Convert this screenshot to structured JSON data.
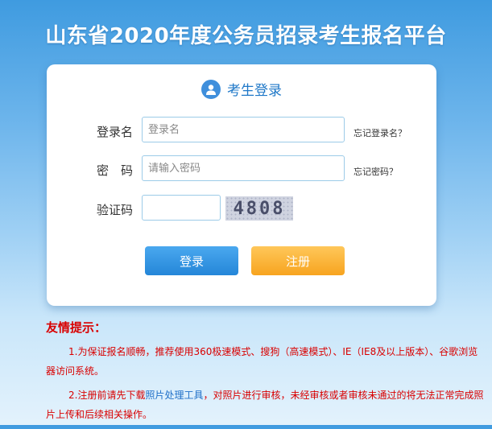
{
  "page": {
    "title": "山东省2020年度公务员招录考生报名平台"
  },
  "login": {
    "heading": "考生登录",
    "username_label": "登录名",
    "username_placeholder": "登录名",
    "forgot_username": "忘记登录名？",
    "password_label": "密　码",
    "password_placeholder": "请输入密码",
    "forgot_password": "忘记密码？",
    "captcha_label": "验证码",
    "captcha_value": "",
    "captcha_text": "4808",
    "login_button": "登录",
    "register_button": "注册"
  },
  "tips": {
    "title": "友情提示：",
    "tip1": "1.为保证报名顺畅，推荐使用360极速模式、搜狗（高速模式）、IE（IE8及以上版本）、谷歌浏览器访问系统。",
    "tip2_before": "2.注册前请先下载",
    "tip2_link": "照片处理工具",
    "tip2_after": "，对照片进行审核，未经审核或者审核未通过的将无法正常完成照片上传和后续相关操作。"
  },
  "colors": {
    "accent": "#2486d8",
    "register": "#f7a41f",
    "tips": "#d90000"
  },
  "icons": [
    "user-icon"
  ]
}
